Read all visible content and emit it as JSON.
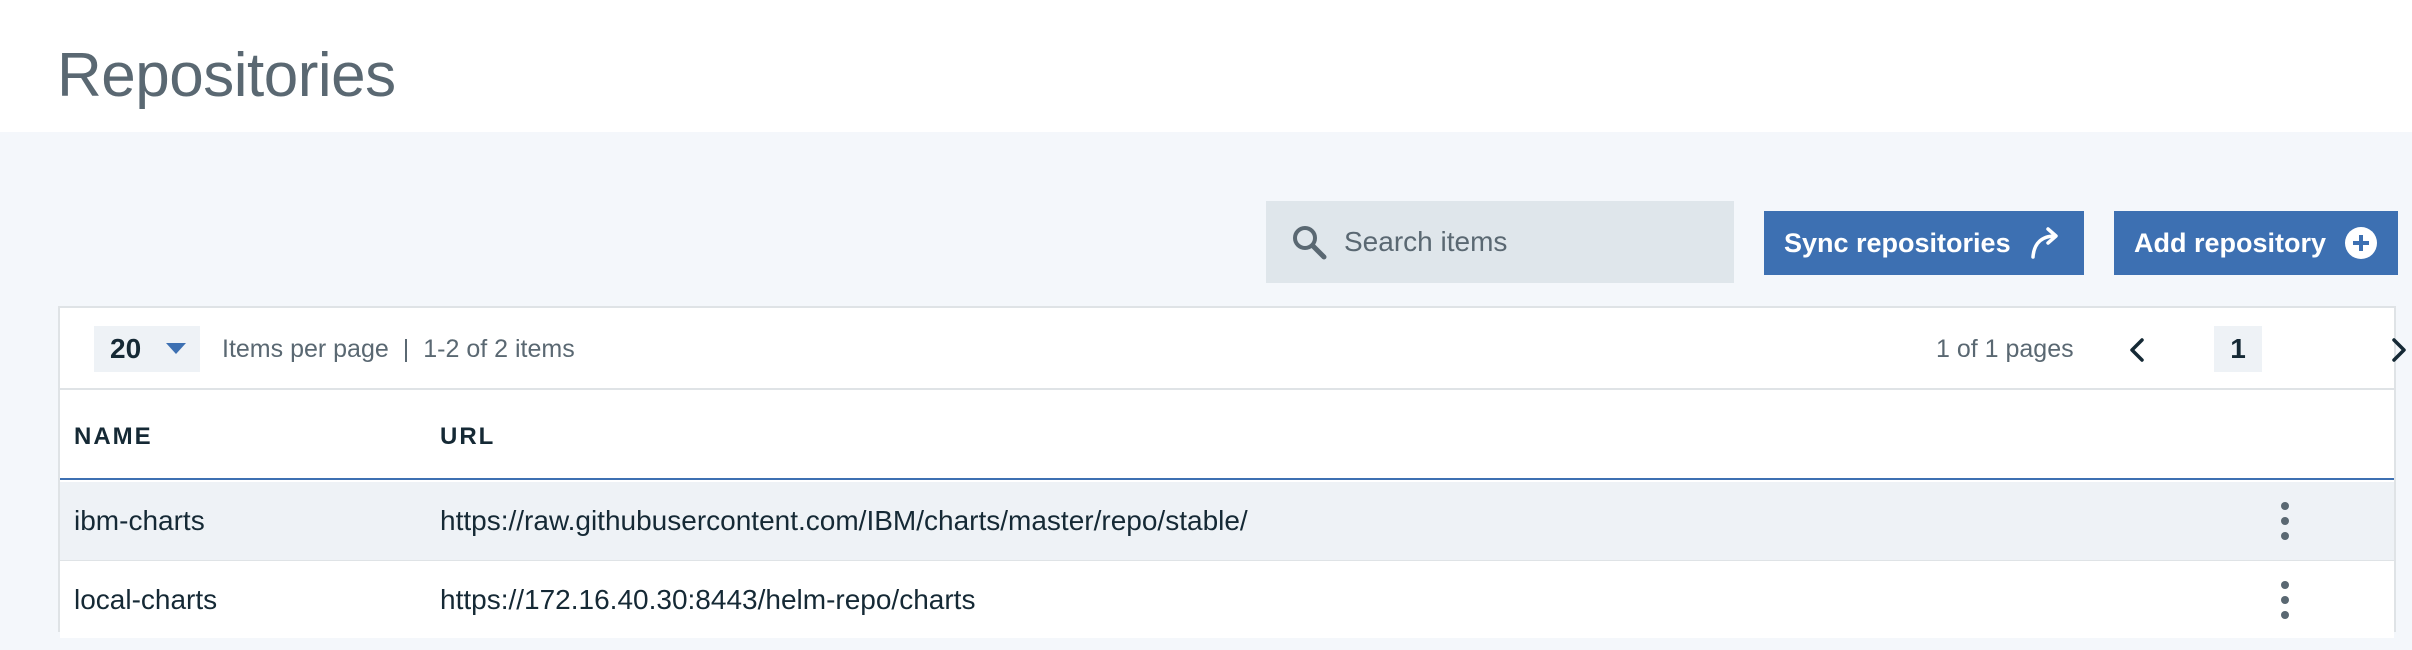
{
  "page": {
    "title": "Repositories"
  },
  "toolbar": {
    "search_placeholder": "Search items",
    "search_icon": "search-icon",
    "sync_label": "Sync repositories",
    "sync_icon": "sync-arrow-icon",
    "add_label": "Add repository",
    "add_icon": "add-circle-icon"
  },
  "pagination": {
    "per_page": "20",
    "items_per_page_label": "Items per page",
    "separator": "|",
    "range_text": "1-2 of 2 items",
    "pages_text": "1 of 1 pages",
    "current_page": "1"
  },
  "table": {
    "columns": [
      "NAME",
      "URL"
    ],
    "rows": [
      {
        "name": "ibm-charts",
        "url": "https://raw.githubusercontent.com/IBM/charts/master/repo/stable/"
      },
      {
        "name": "local-charts",
        "url": "https://172.16.40.30:8443/helm-repo/charts"
      }
    ]
  },
  "colors": {
    "primary": "#3d70b2",
    "background": "#f4f7fb",
    "text": "#152935",
    "muted": "#5a6872"
  }
}
